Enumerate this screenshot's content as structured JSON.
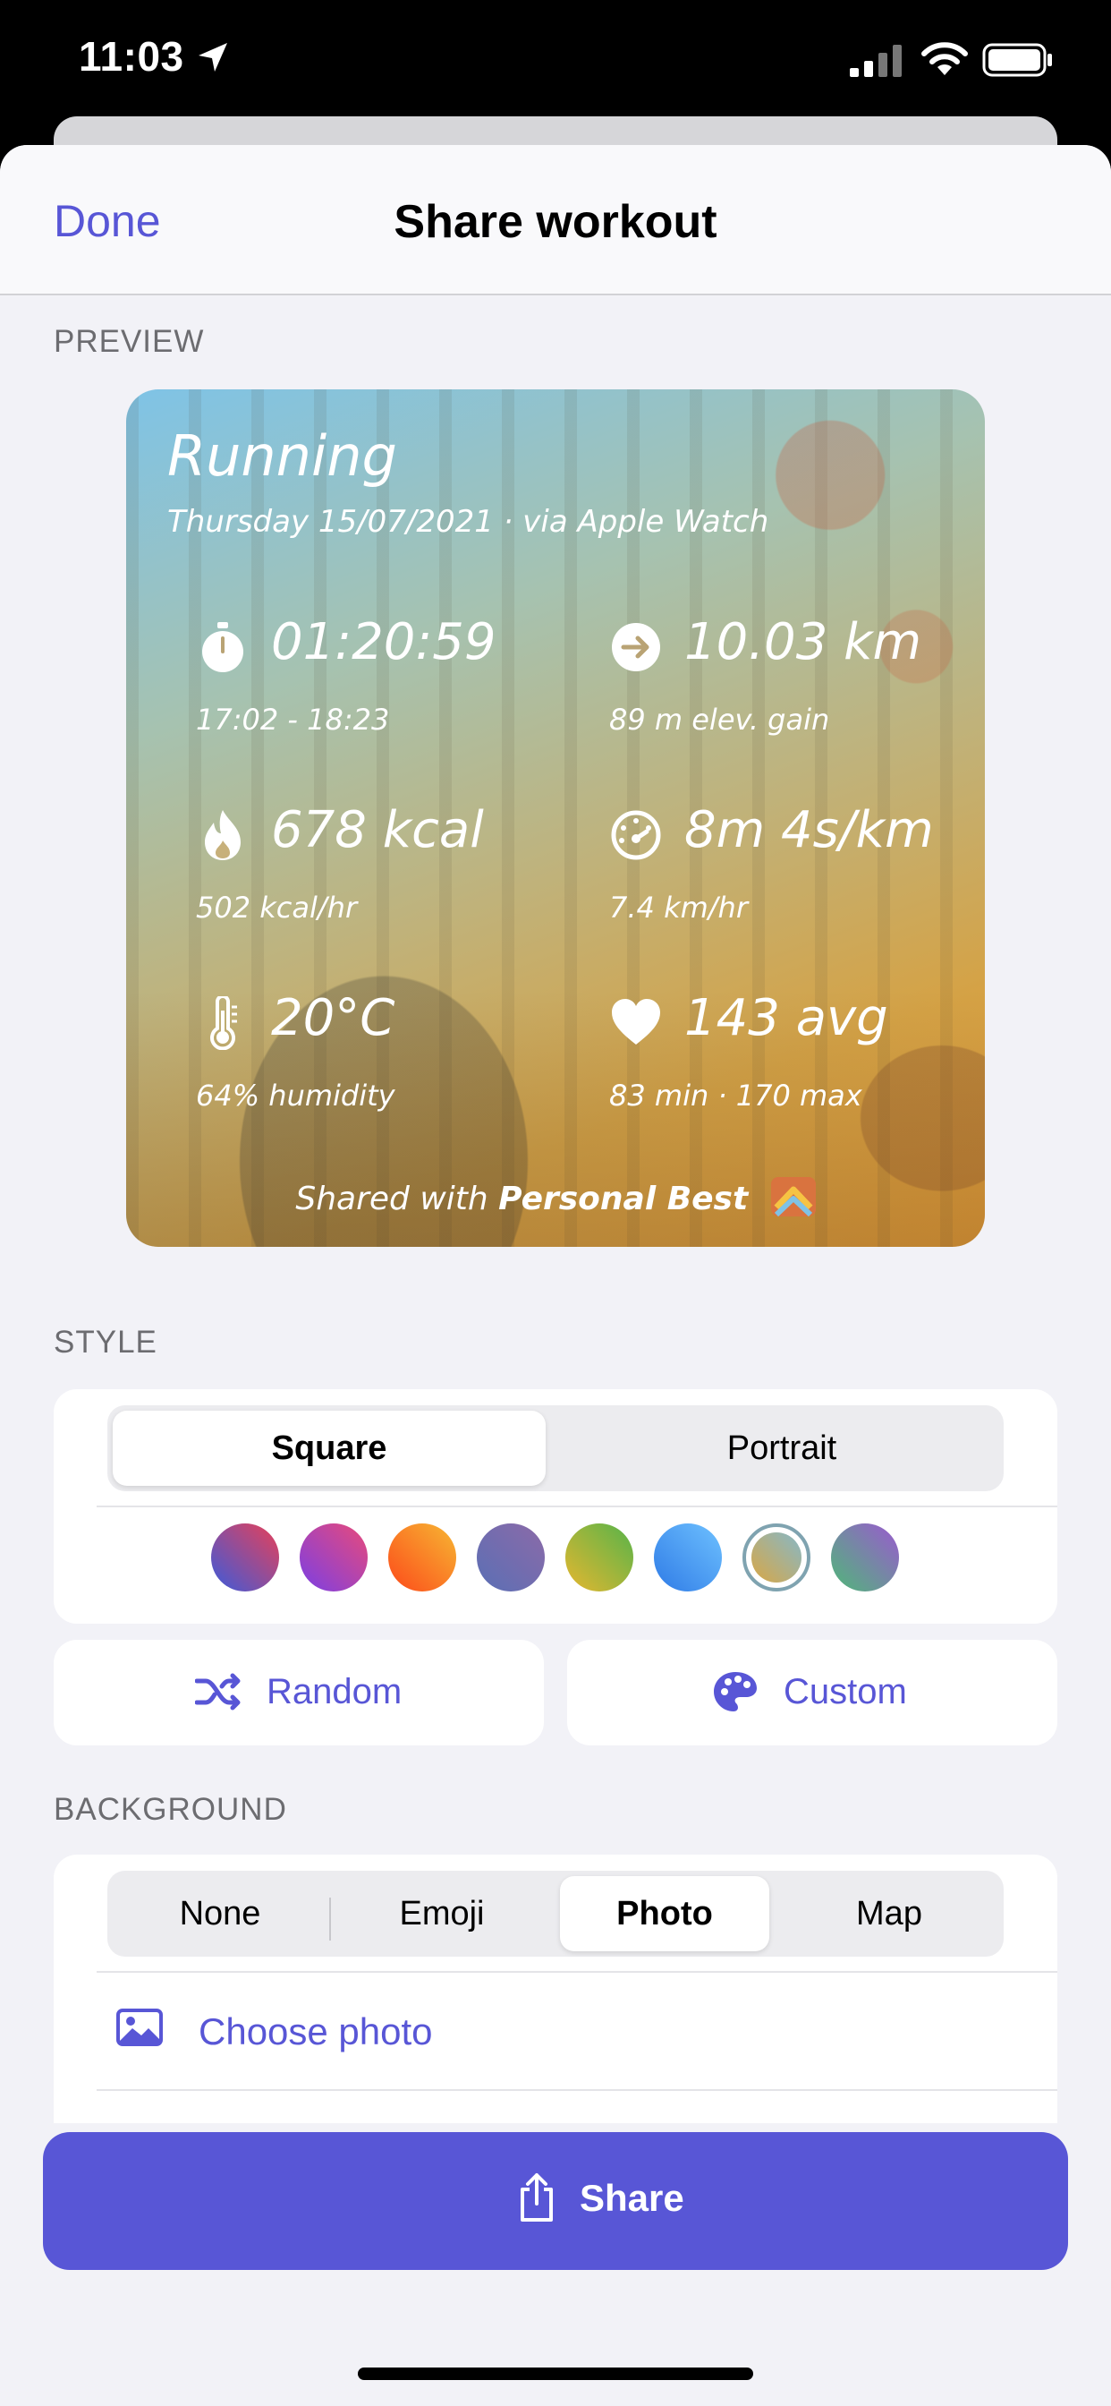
{
  "status_bar": {
    "time": "11:03"
  },
  "nav": {
    "done_label": "Done",
    "title": "Share workout"
  },
  "preview": {
    "section_label": "PREVIEW",
    "activity": "Running",
    "subtitle": "Thursday 15/07/2021 · via Apple Watch",
    "stats": [
      {
        "icon": "stopwatch-icon",
        "main": "01:20:59",
        "sub": "17:02 - 18:23"
      },
      {
        "icon": "arrow-right-circle-icon",
        "main": "10.03 km",
        "sub": "89 m elev. gain"
      },
      {
        "icon": "flame-icon",
        "main": "678 kcal",
        "sub": "502 kcal/hr"
      },
      {
        "icon": "speedometer-icon",
        "main": "8m 4s/km",
        "sub": "7.4 km/hr"
      },
      {
        "icon": "thermometer-icon",
        "main": "20°C",
        "sub": "64% humidity"
      },
      {
        "icon": "heart-icon",
        "main": "143 avg",
        "sub": "83 min · 170 max"
      }
    ],
    "footer_prefix": "Shared with",
    "footer_app": "Personal Best"
  },
  "style": {
    "section_label": "STYLE",
    "segments": [
      "Square",
      "Portrait"
    ],
    "selected_segment": "Square",
    "swatches": [
      {
        "from": "#e94057",
        "to": "#3b5bdb"
      },
      {
        "from": "#7b3fe4",
        "to": "#e94a7a"
      },
      {
        "from": "#f7b733",
        "to": "#fc4a1a"
      },
      {
        "from": "#5a6fb5",
        "to": "#8c6aa8"
      },
      {
        "from": "#56b44a",
        "to": "#e6b62f"
      },
      {
        "from": "#2f7be6",
        "to": "#6ec1ff"
      },
      {
        "from": "#86b8c8",
        "to": "#d8a746"
      },
      {
        "from": "#9b59d0",
        "to": "#4fb878"
      }
    ],
    "selected_swatch_index": 6,
    "random_label": "Random",
    "custom_label": "Custom"
  },
  "background": {
    "section_label": "BACKGROUND",
    "segments": [
      "None",
      "Emoji",
      "Photo",
      "Map"
    ],
    "selected_segment": "Photo",
    "choose_photo_label": "Choose photo"
  },
  "share": {
    "label": "Share"
  },
  "colors": {
    "accent": "#5856d6",
    "sheet_bg": "#f2f2f7"
  }
}
